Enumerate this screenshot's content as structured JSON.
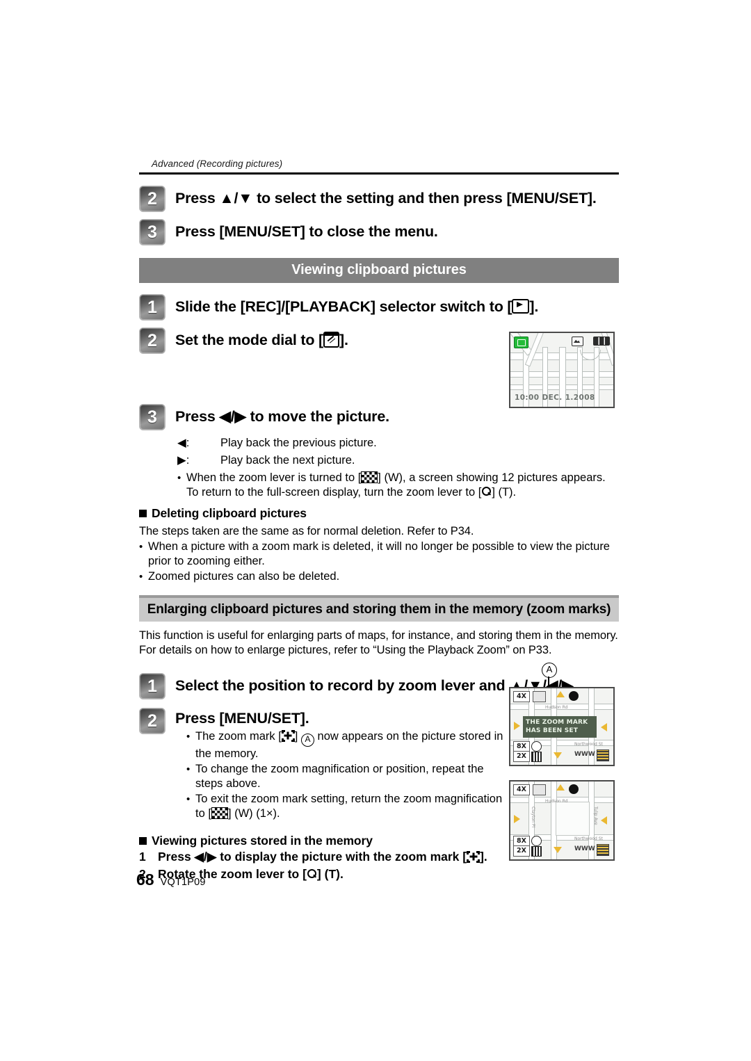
{
  "running_head": "Advanced (Recording pictures)",
  "steps_top": [
    {
      "number": "2",
      "text_before": "Press ",
      "arrows": "▲/▼",
      "text_after": " to select the setting and then press [MENU/SET]."
    },
    {
      "number": "3",
      "text_before": "Press [MENU/SET] to close the menu.",
      "arrows": "",
      "text_after": ""
    }
  ],
  "section_viewing": {
    "title": "Viewing clipboard pictures",
    "step1": {
      "number": "1",
      "prefix": "Slide the [REC]/[PLAYBACK] selector switch to [",
      "suffix": "]."
    },
    "step2": {
      "number": "2",
      "prefix": "Set the mode dial to [",
      "suffix": "]."
    },
    "step3": {
      "number": "3",
      "prefix": "Press ",
      "arrows": "◀/▶",
      "suffix": " to move the picture."
    },
    "key_rows": [
      {
        "key": "◀:",
        "value": "Play back the previous picture."
      },
      {
        "key": "▶:",
        "value": "Play back the next picture."
      }
    ],
    "bullet_zoom": {
      "part1": "When the zoom lever is turned to [",
      "part2": "] (W), a screen showing 12 pictures appears. To return to the full-screen display, turn the zoom lever to [",
      "part3": "] (T)."
    }
  },
  "section_deleting": {
    "heading": "Deleting clipboard pictures",
    "paragraph": "The steps taken are the same as for normal deletion. Refer to P34.",
    "bullets": [
      "When a picture with a zoom mark is deleted, it will no longer be possible to view the picture prior to zooming either.",
      "Zoomed pictures can also be deleted."
    ]
  },
  "section_enlarging": {
    "title": "Enlarging clipboard pictures and storing them in the memory (zoom marks)",
    "paragraph": "This function is useful for enlarging parts of maps, for instance, and storing them in the memory. For details on how to enlarge pictures, refer to “Using the Playback Zoom” on P33.",
    "step1": {
      "number": "1",
      "prefix": "Select the position to record by zoom lever and ",
      "arrows": "▲/▼/◀/▶",
      "suffix": "."
    },
    "step2": {
      "number": "2",
      "text": "Press [MENU/SET]."
    },
    "step2_bullets": {
      "b1_part1": "The zoom mark [",
      "b1_part2": "] ",
      "b1_part3": " now appears on the picture stored in the memory.",
      "b2": "To change the zoom magnification or position, repeat the steps above.",
      "b3_part1": "To exit the zoom mark setting, return the zoom magnification to [",
      "b3_part2": "] (W) (1×)."
    }
  },
  "section_viewing_memory": {
    "heading": "Viewing pictures stored in the memory",
    "items": [
      {
        "n": "1",
        "prefix": "Press ",
        "arrows": "◀/▶",
        "mid": " to display the picture with the zoom mark [",
        "suffix": "]."
      },
      {
        "n": "2",
        "prefix": "Rotate the zoom lever to [",
        "arrows": "",
        "mid": "",
        "suffix": "] (T)."
      }
    ]
  },
  "screens": {
    "map_clipboard": {
      "name": "clipboard-map-screen",
      "date_text": "10:00 DEC. 1.2008"
    },
    "zoom_mark_set": {
      "name": "zoom-mark-set-screen",
      "message": "THE ZOOM MARK HAS BEEN SET",
      "osd_left_top": "4X",
      "osd_left_bottom_1": "8X",
      "osd_left_bottom_2": "2X",
      "street_label_top": "Hudson Rd",
      "street_label_right": "Northwood St",
      "www_label": "WWW"
    },
    "zoom_mark_view": {
      "name": "zoom-mark-view-screen",
      "osd_left_top": "4X",
      "osd_left_bottom_1": "8X",
      "osd_left_bottom_2": "2X",
      "street_label_top": "Hudson Rd",
      "street_label_right": "Northwood St",
      "street_label_left": "Clayton Pl",
      "street_label_right2": "Tulip Ave",
      "www_label": "WWW"
    },
    "callout_a": "A"
  },
  "footer": {
    "page_number": "68",
    "document_code": "VQT1P09"
  },
  "colors": {
    "bar_dark": "#808080",
    "bar_light": "#c9c9c9",
    "bar_light_border": "#9a9a9a",
    "text": "#000000",
    "screen_green_tag": "#24bb39",
    "message_band": "#4f5e4c"
  }
}
